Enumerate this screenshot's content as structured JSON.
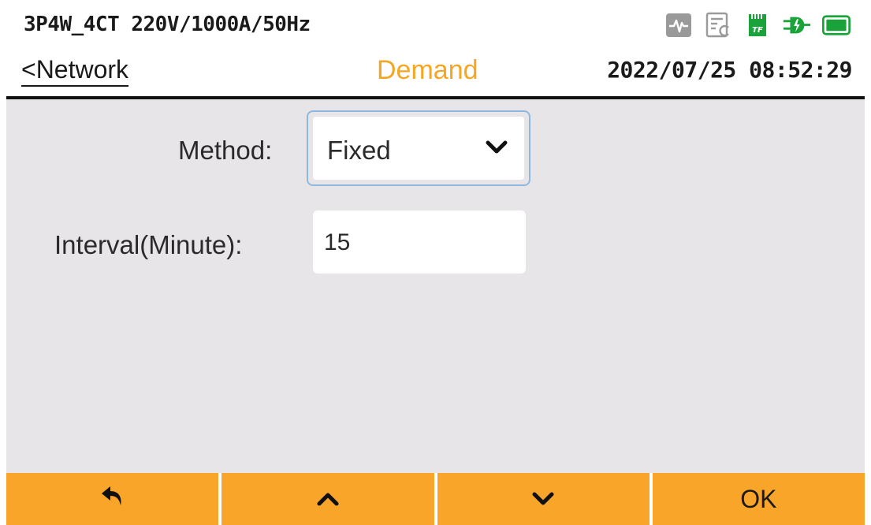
{
  "header": {
    "config": "3P4W_4CT 220V/1000A/50Hz",
    "back_label": "<Network",
    "title": "Demand",
    "datetime": "2022/07/25 08:52:29",
    "status_icons": [
      "waveform-icon",
      "recording-icon",
      "tf-card-icon",
      "power-plug-icon",
      "battery-icon"
    ]
  },
  "form": {
    "method_label": "Method:",
    "method_value": "Fixed",
    "interval_label": "Interval(Minute):",
    "interval_value": "15"
  },
  "footer": {
    "buttons": [
      "back-arrow-icon",
      "up-chevron-icon",
      "down-chevron-icon",
      "OK"
    ],
    "ok_label": "OK"
  },
  "colors": {
    "accent": "#f8a52a",
    "title": "#f5a623",
    "content_bg": "#e8e5e8",
    "icon_green": "#1aa33a",
    "icon_gray": "#9a9a9a"
  }
}
